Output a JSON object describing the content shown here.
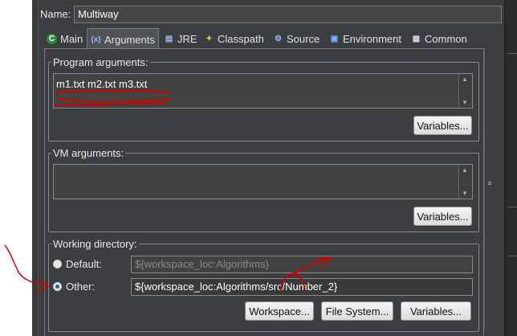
{
  "name": {
    "label": "Name:",
    "value": "Multiway"
  },
  "tabs": [
    {
      "label": "Main",
      "icon": "main-c-icon"
    },
    {
      "label": "Arguments",
      "icon": "arguments-icon"
    },
    {
      "label": "JRE",
      "icon": "jre-icon"
    },
    {
      "label": "Classpath",
      "icon": "classpath-icon"
    },
    {
      "label": "Source",
      "icon": "source-icon"
    },
    {
      "label": "Environment",
      "icon": "environment-icon"
    },
    {
      "label": "Common",
      "icon": "common-icon"
    }
  ],
  "program_arguments": {
    "title": "Program arguments:",
    "value": "m1.txt m2.txt m3.txt",
    "variables_label": "Variables..."
  },
  "vm_arguments": {
    "title": "VM arguments:",
    "value": "",
    "variables_label": "Variables..."
  },
  "working_directory": {
    "title": "Working directory:",
    "default_label": "Default:",
    "default_value": "${workspace_loc:Algorithms}",
    "other_label": "Other:",
    "other_value": "${workspace_loc:Algorithms/src/Number_2}",
    "selected": "other",
    "workspace_label": "Workspace...",
    "filesystem_label": "File System...",
    "variables_label": "Variables..."
  },
  "colors": {
    "annotation": "#d40000",
    "accent_radio": "#2b5fb8"
  }
}
